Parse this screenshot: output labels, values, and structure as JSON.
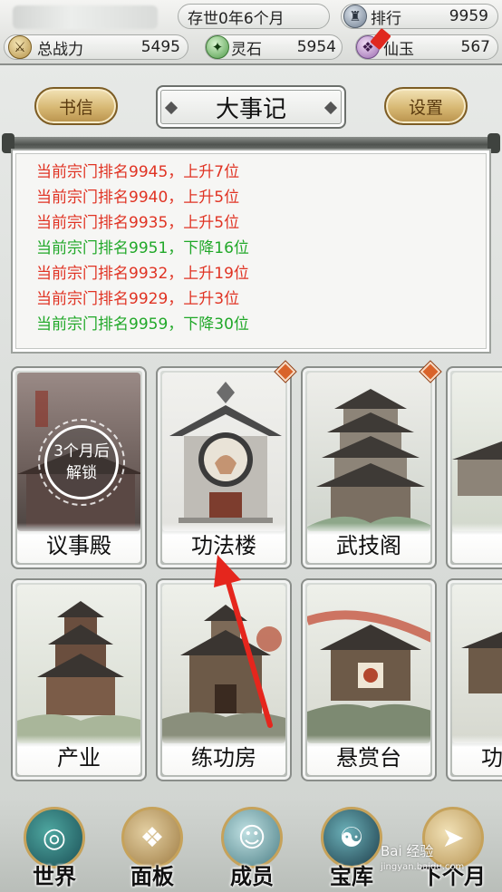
{
  "status": {
    "time_label": "存世0年6个月",
    "rank_label": "排行",
    "rank_value": "9959",
    "power_label": "总战力",
    "power_value": "5495",
    "stone_label": "灵石",
    "stone_value": "5954",
    "jade_label": "仙玉",
    "jade_value": "567"
  },
  "header": {
    "left_button": "书信",
    "title": "大事记",
    "right_button": "设置"
  },
  "log": [
    {
      "text": "当前宗门排名9945，上升7位",
      "trend": "up"
    },
    {
      "text": "当前宗门排名9940，上升5位",
      "trend": "up"
    },
    {
      "text": "当前宗门排名9935，上升5位",
      "trend": "up"
    },
    {
      "text": "当前宗门排名9951，下降16位",
      "trend": "down"
    },
    {
      "text": "当前宗门排名9932，上升19位",
      "trend": "up"
    },
    {
      "text": "当前宗门排名9929，上升3位",
      "trend": "up"
    },
    {
      "text": "当前宗门排名9959，下降30位",
      "trend": "down"
    }
  ],
  "buildings_row1": [
    {
      "label": "议事殿",
      "locked": true,
      "lock_line1": "3个月后",
      "lock_line2": "解锁"
    },
    {
      "label": "功法楼",
      "locked": false
    },
    {
      "label": "武技阁",
      "locked": false
    },
    {
      "label": "",
      "locked": false
    }
  ],
  "buildings_row2": [
    {
      "label": "产业"
    },
    {
      "label": "练功房"
    },
    {
      "label": "悬赏台"
    },
    {
      "label": "功"
    }
  ],
  "nav": [
    {
      "label": "世界",
      "icon": "world-icon"
    },
    {
      "label": "面板",
      "icon": "scroll-icon"
    },
    {
      "label": "成员",
      "icon": "member-icon"
    },
    {
      "label": "宝库",
      "icon": "treasury-icon"
    },
    {
      "label": "下个月",
      "icon": "next-month-icon"
    }
  ],
  "watermark": {
    "line1": "Bai 经验",
    "line2": "jingyan.baidu.com"
  },
  "colors": {
    "rank_up": "#e03323",
    "rank_down": "#21a829",
    "gold_button": "#d7b873",
    "annotation_arrow": "#e5261d"
  }
}
